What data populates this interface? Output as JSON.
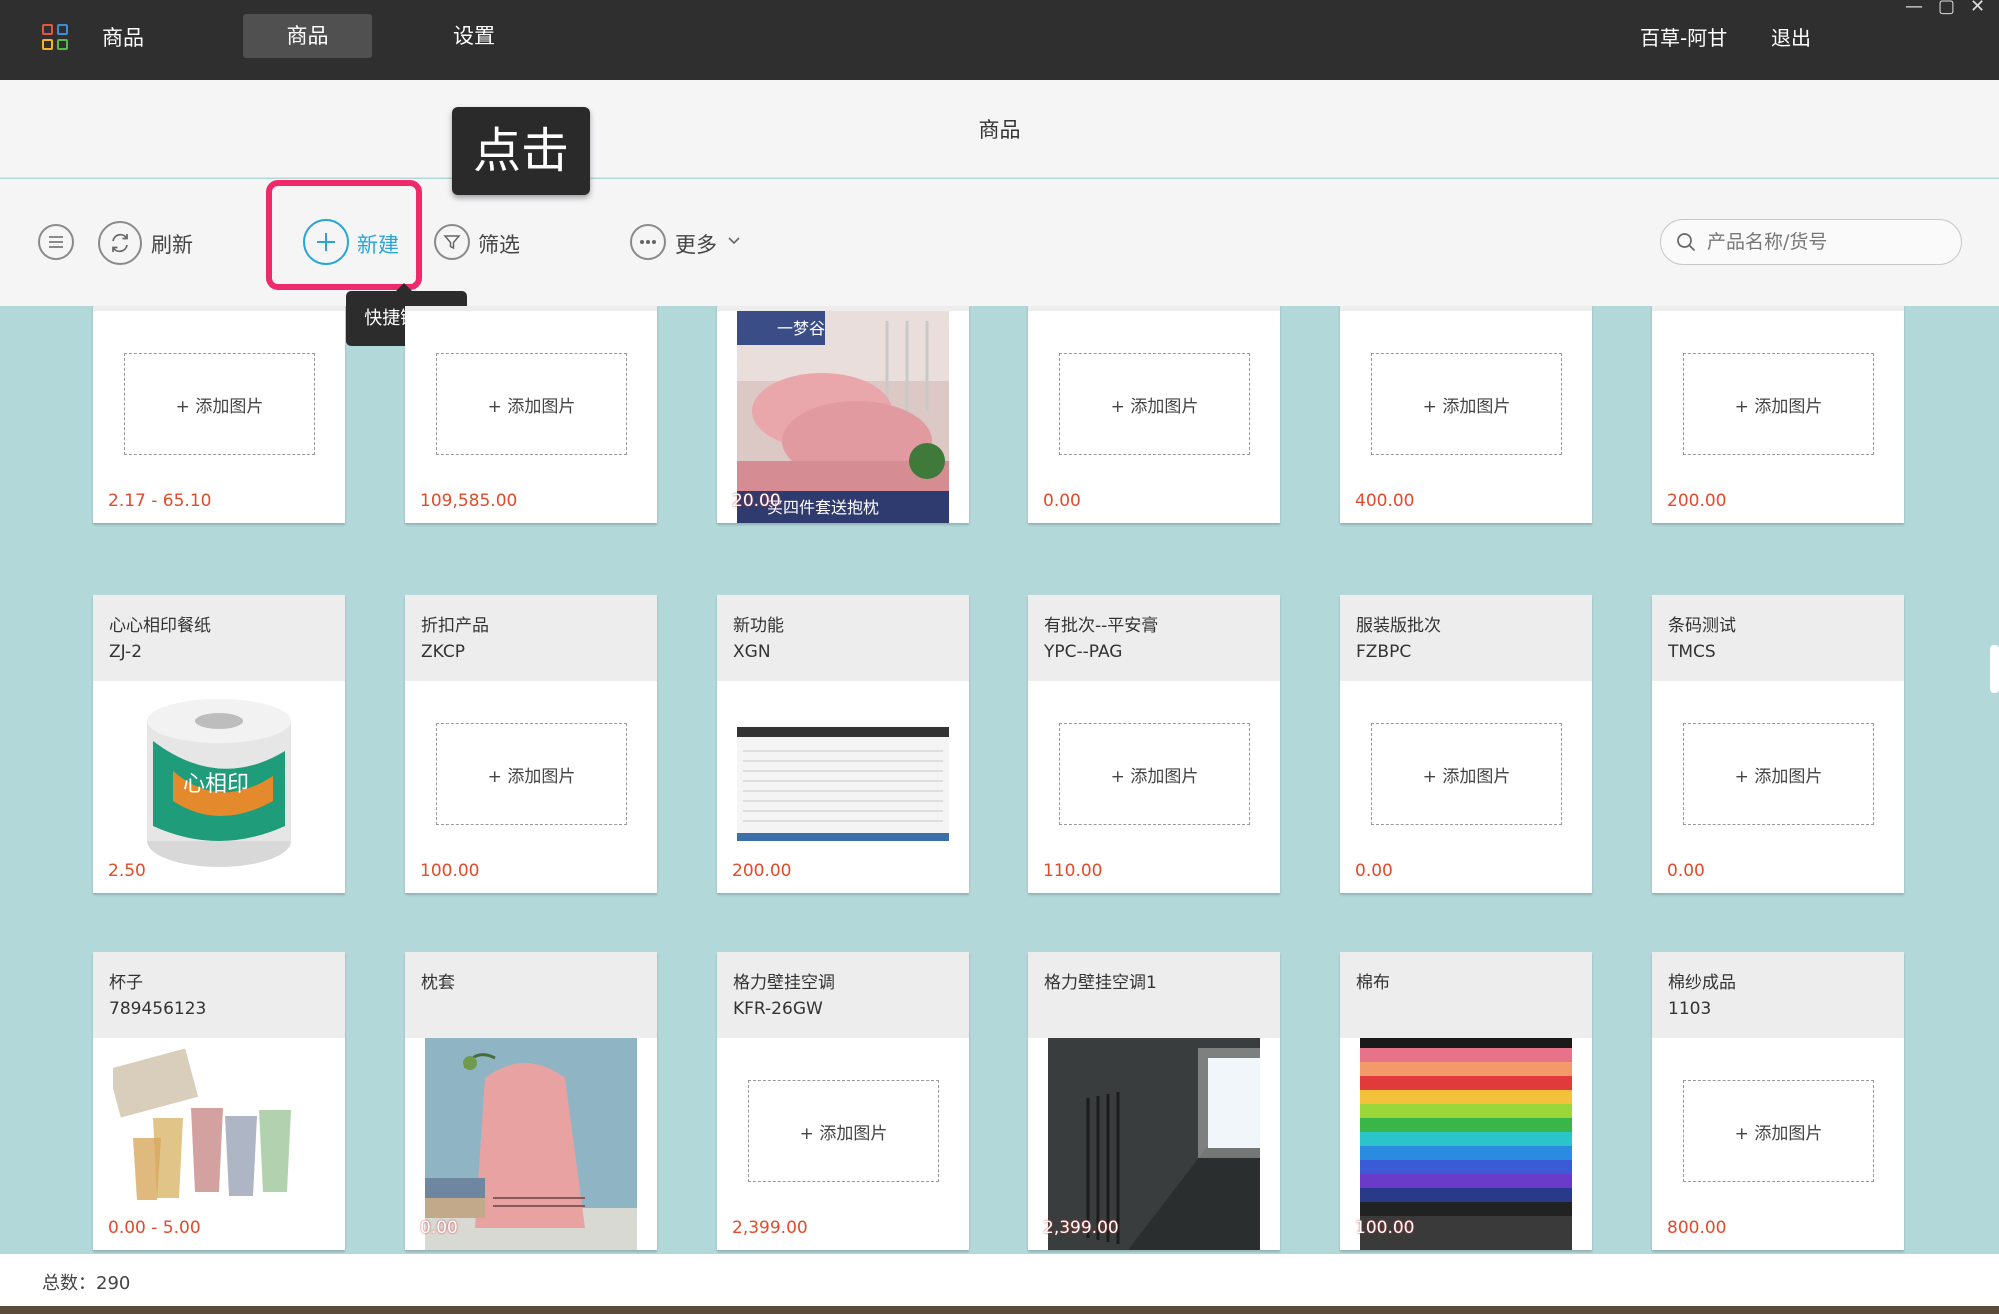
{
  "topbar": {
    "app_title": "商品",
    "tabs": [
      {
        "label": "商品",
        "active": true
      },
      {
        "label": "设置",
        "active": false
      }
    ],
    "user": "百草-阿甘",
    "logout": "退出",
    "window_controls": [
      "—",
      "▢",
      "✕"
    ]
  },
  "header": {
    "title": "商品"
  },
  "toolbar": {
    "refresh": "刷新",
    "new": "新建",
    "filter": "筛选",
    "more": "更多",
    "search_placeholder": "产品名称/货号",
    "click_tip": "点击",
    "shortcut_tip": "快捷键：C"
  },
  "colors": {
    "accent": "#2aa6d6",
    "highlight": "#ee2a6b",
    "price": "#e24b2a",
    "background": "#b3d8da"
  },
  "products": [
    {
      "name": "",
      "code": "",
      "image": null,
      "add_label": "+ 添加图片",
      "price": "2.17 - 65.10"
    },
    {
      "name": "",
      "code": "",
      "image": null,
      "add_label": "+ 添加图片",
      "price": "109,585.00"
    },
    {
      "name": "",
      "code": "",
      "image": "bedding",
      "image_caption": "一梦谷",
      "image_caption2": "买四件套送抱枕",
      "price": "20.00"
    },
    {
      "name": "",
      "code": "",
      "image": null,
      "add_label": "+ 添加图片",
      "price": "0.00"
    },
    {
      "name": "",
      "code": "",
      "image": null,
      "add_label": "+ 添加图片",
      "price": "400.00"
    },
    {
      "name": "",
      "code": "",
      "image": null,
      "add_label": "+ 添加图片",
      "price": "200.00"
    },
    {
      "name": "心心相印餐纸",
      "code": "ZJ-2",
      "image": "tissue",
      "image_caption": "心相印",
      "price": "2.50"
    },
    {
      "name": "折扣产品",
      "code": "ZKCP",
      "image": null,
      "add_label": "+ 添加图片",
      "price": "100.00"
    },
    {
      "name": "新功能",
      "code": "XGN",
      "image": "screenshot",
      "price": "200.00"
    },
    {
      "name": "有批次--平安膏",
      "code": "YPC--PAG",
      "image": null,
      "add_label": "+ 添加图片",
      "price": "110.00"
    },
    {
      "name": "服装版批次",
      "code": "FZBPC",
      "image": null,
      "add_label": "+ 添加图片",
      "price": "0.00"
    },
    {
      "name": "条码测试",
      "code": "TMCS",
      "image": null,
      "add_label": "+ 添加图片",
      "price": "0.00"
    },
    {
      "name": "杯子",
      "code": "789456123",
      "image": "cups",
      "price": "0.00 - 5.00"
    },
    {
      "name": "枕套",
      "code": "",
      "image": "towel",
      "price": "0.00"
    },
    {
      "name": "格力壁挂空调",
      "code": "KFR-26GW",
      "image": null,
      "add_label": "+ 添加图片",
      "price": "2,399.00"
    },
    {
      "name": "格力壁挂空调1",
      "code": "",
      "image": "aircon",
      "price": "2,399.00"
    },
    {
      "name": "棉布",
      "code": "",
      "image": "cloth",
      "price": "100.00"
    },
    {
      "name": "棉纱成品",
      "code": "1103",
      "image": null,
      "add_label": "+ 添加图片",
      "price": "800.00"
    }
  ],
  "footer": {
    "total_label": "总数：",
    "total": "290"
  }
}
